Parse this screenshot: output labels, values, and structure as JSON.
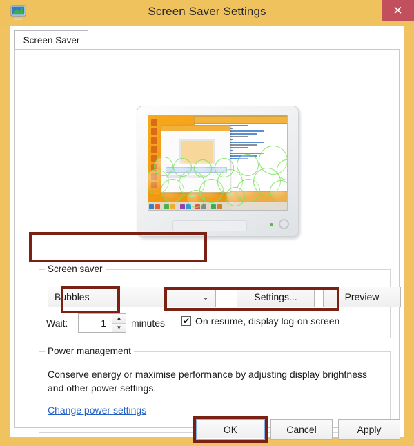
{
  "window": {
    "title": "Screen Saver Settings",
    "icon": "monitor-icon",
    "close_label": "✕",
    "titlebar_color": "#f0c25e",
    "close_color": "#c1505c"
  },
  "tabs": [
    {
      "label": "Screen Saver",
      "selected": true
    }
  ],
  "preview": {
    "name": "screen-saver-preview-monitor",
    "screensaver": "Bubbles"
  },
  "screen_saver_group": {
    "label": "Screen saver",
    "combo_value": "Bubbles",
    "combo_chevron": "⌄",
    "settings_label": "Settings...",
    "preview_label": "Preview",
    "wait_label": "Wait:",
    "wait_value": "1",
    "spin_up": "▲",
    "spin_down": "▼",
    "minutes_label": "minutes",
    "checkbox_checked": true,
    "checkbox_mark": "✔",
    "checkbox_label": "On resume, display log-on screen"
  },
  "power_group": {
    "label": "Power management",
    "description": "Conserve energy or maximise performance by adjusting display brightness and other power settings.",
    "link_label": "Change power settings",
    "link_color": "#2361c8"
  },
  "footer": {
    "ok_label": "OK",
    "cancel_label": "Cancel",
    "apply_label": "Apply"
  },
  "annotations": {
    "color": "#7b2113",
    "targets": [
      "screen-saver-combo",
      "wait-spinner",
      "on-resume-checkbox",
      "ok-button"
    ]
  }
}
